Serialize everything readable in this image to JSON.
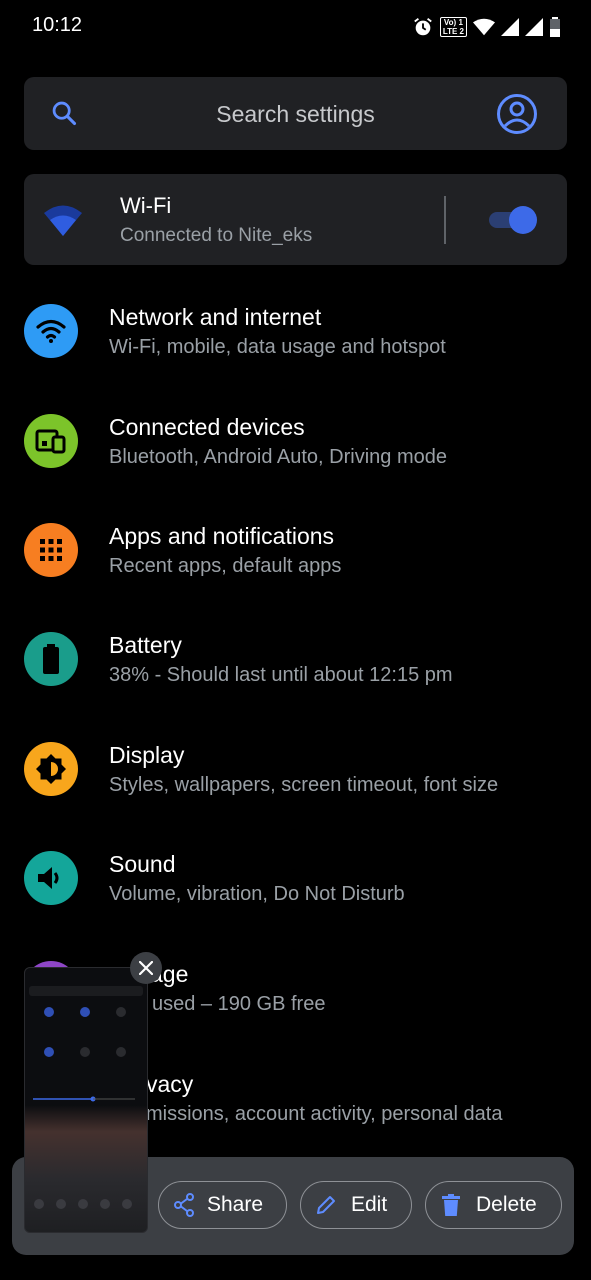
{
  "status_bar": {
    "time": "10:12",
    "volte_top": "Vo) 1",
    "volte_bottom": "LTE 2"
  },
  "search": {
    "placeholder": "Search settings"
  },
  "wifi_card": {
    "title": "Wi-Fi",
    "subtitle": "Connected to Nite_eks",
    "toggle_on": true
  },
  "settings": [
    {
      "title": "Network and internet",
      "subtitle": "Wi-Fi, mobile, data usage and hotspot",
      "icon": "wifi-icon",
      "color": "#2e9bf5"
    },
    {
      "title": "Connected devices",
      "subtitle": "Bluetooth, Android Auto, Driving mode",
      "icon": "devices-icon",
      "color": "#7cc42a"
    },
    {
      "title": "Apps and notifications",
      "subtitle": "Recent apps, default apps",
      "icon": "apps-grid-icon",
      "color": "#f77e21"
    },
    {
      "title": "Battery",
      "subtitle": "38% - Should last until about 12:15 pm",
      "icon": "battery-icon",
      "color": "#1a9d8b"
    },
    {
      "title": "Display",
      "subtitle": "Styles, wallpapers, screen timeout, font size",
      "icon": "brightness-icon",
      "color": "#f8a61c"
    },
    {
      "title": "Sound",
      "subtitle": "Volume, vibration, Do Not Disturb",
      "icon": "volume-icon",
      "color": "#14a69a"
    },
    {
      "title": "age",
      "subtitle": "used – 190 GB free",
      "icon": "storage-icon",
      "color": "#8e46c6"
    },
    {
      "title": "vacy",
      "subtitle": "missions, account activity, personal data",
      "icon": "privacy-icon",
      "color": "#5f6368"
    }
  ],
  "screenshot_actions": {
    "share": "Share",
    "edit": "Edit",
    "delete": "Delete"
  },
  "colors": {
    "accent": "#3d6ae8",
    "card_bg": "#202124",
    "bar_bg": "#3c3f44"
  }
}
